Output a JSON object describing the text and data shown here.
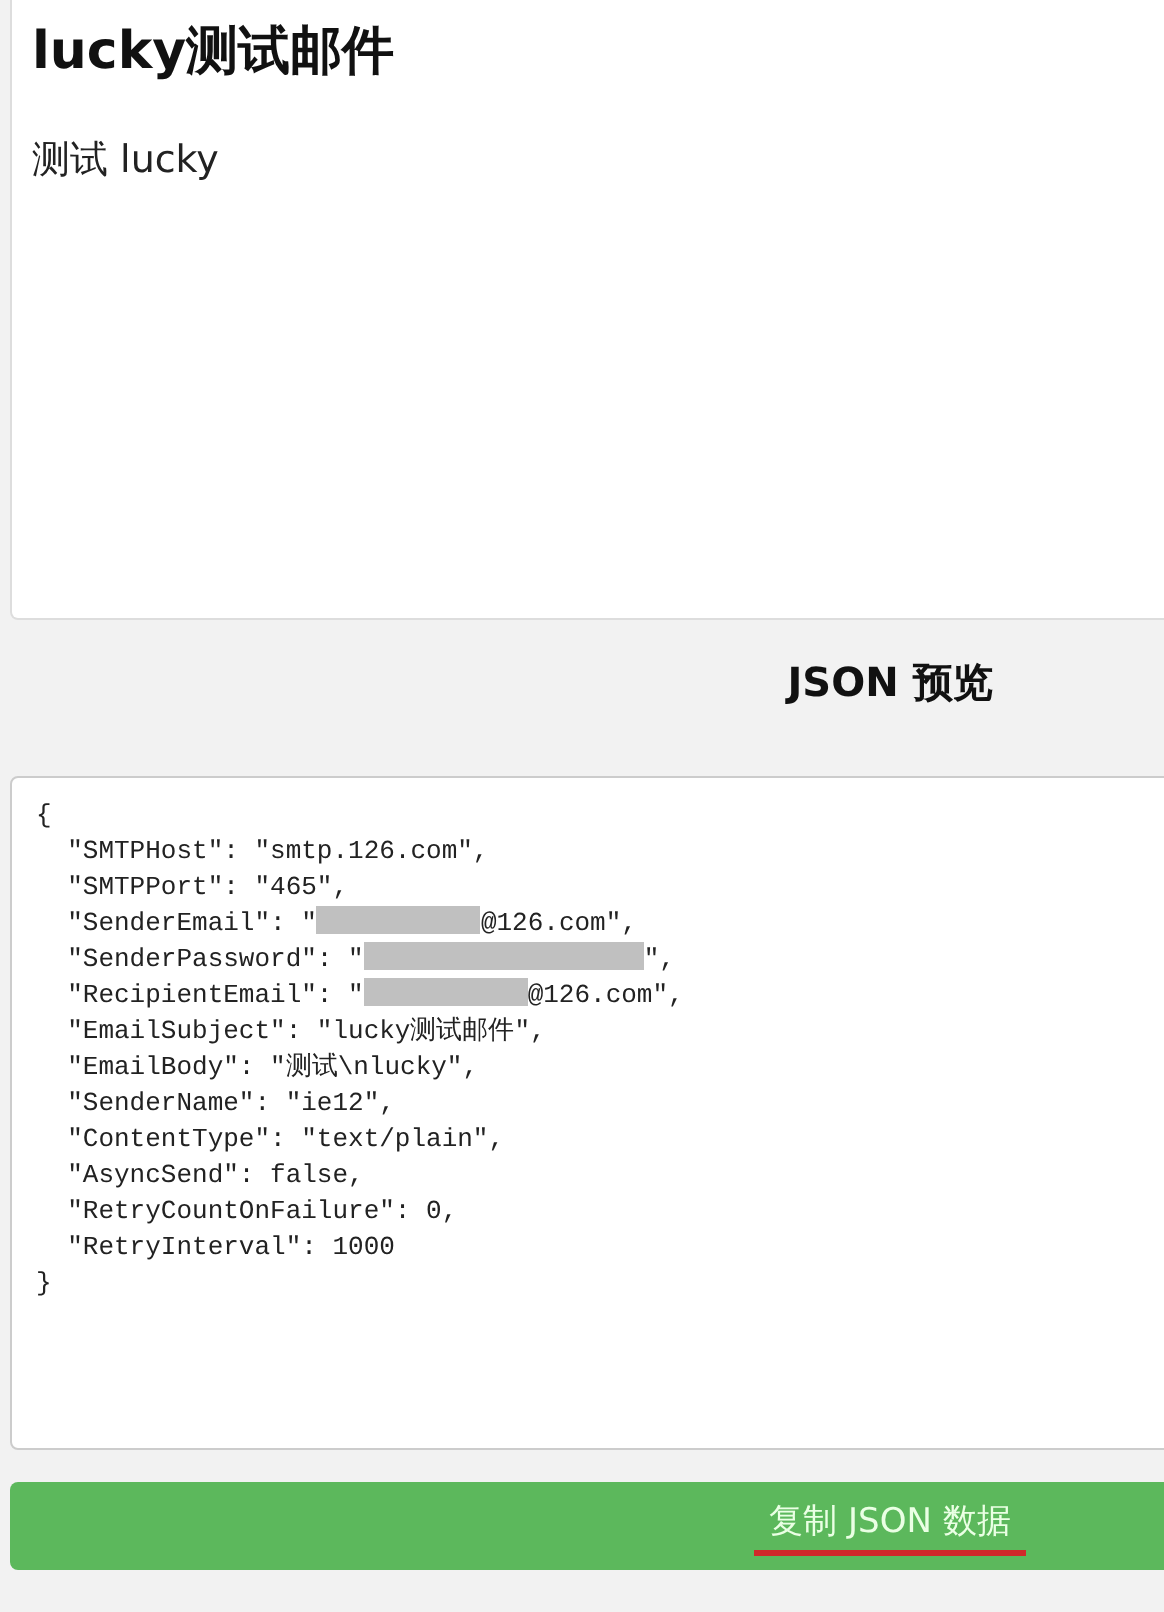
{
  "preview": {
    "title": "lucky测试邮件",
    "body": "测试 lucky"
  },
  "json_preview": {
    "heading": "JSON 预览",
    "lines": [
      {
        "text": "{"
      },
      {
        "text": "  \"SMTPHost\": \"smtp.126.com\","
      },
      {
        "text": "  \"SMTPPort\": \"465\","
      },
      {
        "text": "  \"SenderEmail\": \"",
        "redacted": true,
        "after": "@126.com\","
      },
      {
        "text": "  \"SenderPassword\": \"",
        "redacted": true,
        "after": "\","
      },
      {
        "text": "  \"RecipientEmail\": \"",
        "redacted": true,
        "after": "@126.com\","
      },
      {
        "text": "  \"EmailSubject\": \"lucky测试邮件\","
      },
      {
        "text": "  \"EmailBody\": \"测试\\nlucky\","
      },
      {
        "text": "  \"SenderName\": \"ie12\","
      },
      {
        "text": "  \"ContentType\": \"text/plain\","
      },
      {
        "text": "  \"AsyncSend\": false,"
      },
      {
        "text": "  \"RetryCountOnFailure\": 0,"
      },
      {
        "text": "  \"RetryInterval\": 1000"
      },
      {
        "text": "}"
      }
    ]
  },
  "copy_button": {
    "label": "复制 JSON 数据",
    "underlined": true
  }
}
